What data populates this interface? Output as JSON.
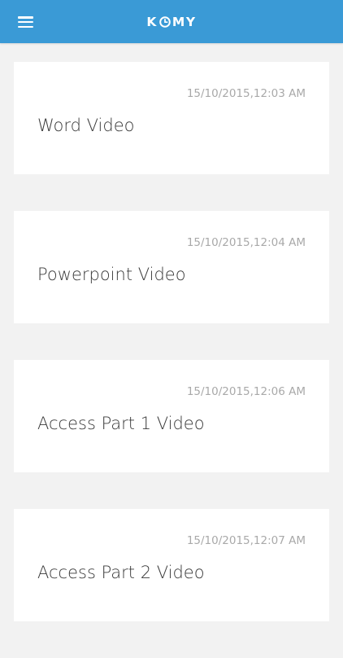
{
  "header": {
    "logo_left": "K",
    "logo_right": "MY",
    "logo_icon": "clock-icon",
    "menu_icon": "hamburger-menu-icon",
    "background_color": "#3a9ad6"
  },
  "videos": [
    {
      "timestamp": "15/10/2015,12:03 AM",
      "title": "Word Video"
    },
    {
      "timestamp": "15/10/2015,12:04 AM",
      "title": "Powerpoint Video"
    },
    {
      "timestamp": "15/10/2015,12:06 AM",
      "title": "Access Part 1 Video"
    },
    {
      "timestamp": "15/10/2015,12:07 AM",
      "title": "Access Part 2 Video"
    }
  ]
}
